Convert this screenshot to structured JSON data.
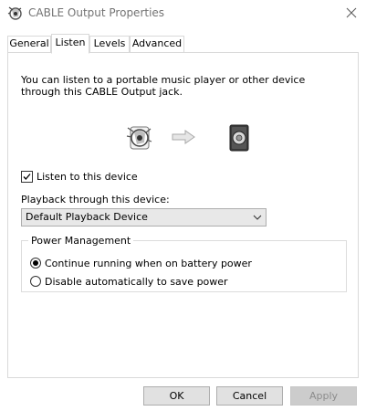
{
  "window": {
    "title": "CABLE Output Properties",
    "icon": "speaker-properties-icon"
  },
  "tabs": [
    {
      "label": "General",
      "active": false
    },
    {
      "label": "Listen",
      "active": true
    },
    {
      "label": "Levels",
      "active": false
    },
    {
      "label": "Advanced",
      "active": false
    }
  ],
  "listen": {
    "description": "You can listen to a portable music player or other device through this CABLE Output jack.",
    "source_icon": "cable-output-device-icon",
    "arrow_icon": "arrow-right-icon",
    "target_icon": "speaker-icon",
    "listen_checkbox": {
      "label": "Listen to this device",
      "checked": true
    },
    "playback_label": "Playback through this device:",
    "playback_select": {
      "value": "Default Playback Device"
    }
  },
  "power": {
    "title": "Power Management",
    "options": [
      {
        "label": "Continue running when on battery power",
        "selected": true
      },
      {
        "label": "Disable automatically to save power",
        "selected": false
      }
    ]
  },
  "buttons": {
    "ok": "OK",
    "cancel": "Cancel",
    "apply": "Apply"
  }
}
